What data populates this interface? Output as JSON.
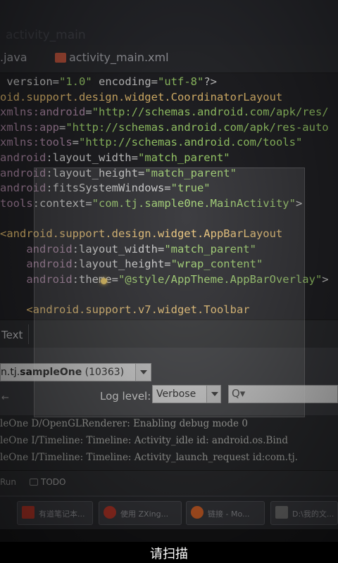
{
  "camera_view": {
    "title_ghost": "activity_main",
    "tabs": {
      "java": ".java",
      "xml": "activity_main.xml"
    },
    "code_lines": [
      [
        {
          "t": " version=",
          "c": "plain"
        },
        {
          "t": "\"1.0\"",
          "c": "str"
        },
        {
          "t": " encoding=",
          "c": "plain"
        },
        {
          "t": "\"utf-8\"",
          "c": "str"
        },
        {
          "t": "?>",
          "c": "plain"
        }
      ],
      [
        {
          "t": "oid.support.design.widget.CoordinatorLayout",
          "c": "tag"
        }
      ],
      [
        {
          "t": "xmlns:",
          "c": "ns"
        },
        {
          "t": "android",
          "c": "ns"
        },
        {
          "t": "=",
          "c": "plain"
        },
        {
          "t": "\"http://schemas.android.com/apk/res/",
          "c": "str"
        }
      ],
      [
        {
          "t": "xmlns:",
          "c": "ns"
        },
        {
          "t": "app",
          "c": "ns"
        },
        {
          "t": "=",
          "c": "plain"
        },
        {
          "t": "\"http://schemas.android.com/apk/res-auto",
          "c": "str"
        }
      ],
      [
        {
          "t": "xmlns:",
          "c": "ns"
        },
        {
          "t": "tools",
          "c": "ns"
        },
        {
          "t": "=",
          "c": "plain"
        },
        {
          "t": "\"http://schemas.android.com/tools\"",
          "c": "str"
        }
      ],
      [
        {
          "t": "android",
          "c": "ns"
        },
        {
          "t": ":layout_width=",
          "c": "plain"
        },
        {
          "t": "\"match_parent\"",
          "c": "str"
        }
      ],
      [
        {
          "t": "android",
          "c": "ns"
        },
        {
          "t": ":layout_height=",
          "c": "plain"
        },
        {
          "t": "\"match_parent\"",
          "c": "str"
        }
      ],
      [
        {
          "t": "android",
          "c": "ns"
        },
        {
          "t": ":fitsSystemWindows=",
          "c": "plain"
        },
        {
          "t": "\"true\"",
          "c": "str"
        }
      ],
      [
        {
          "t": "tools",
          "c": "ns"
        },
        {
          "t": ":context=",
          "c": "plain"
        },
        {
          "t": "\"com.tj.sample0ne.MainActivity\"",
          "c": "str"
        },
        {
          "t": ">",
          "c": "plain"
        }
      ],
      [],
      [
        {
          "t": "<android.support.design.widget.AppBarLayout",
          "c": "tag"
        }
      ],
      [
        {
          "t": "    android",
          "c": "ns"
        },
        {
          "t": ":layout_width=",
          "c": "plain"
        },
        {
          "t": "\"match_parent\"",
          "c": "str"
        }
      ],
      [
        {
          "t": "    android",
          "c": "ns"
        },
        {
          "t": ":layout_height=",
          "c": "plain"
        },
        {
          "t": "\"wrap_content\"",
          "c": "str"
        }
      ],
      [
        {
          "t": "    android",
          "c": "ns"
        },
        {
          "t": ":theme=",
          "c": "plain"
        },
        {
          "t": "\"@style/AppTheme.AppBarOverlay\"",
          "c": "str"
        },
        {
          "t": ">",
          "c": "plain"
        }
      ],
      [],
      [
        {
          "t": "    <android.support.v7.widget.Toolbar",
          "c": "tag"
        }
      ]
    ],
    "panel_tab": "Text",
    "process": {
      "name_prefix": "n.tj.",
      "name_bold": "sampleOne",
      "pid": " (10363)"
    },
    "side_arrow": "←",
    "log_level_label": "Log level:",
    "log_level_value": "Verbose",
    "search_glyph": "Q▾",
    "log_lines": [
      "leOne D/OpenGLRenderer: Enabling debug mode 0",
      "leOne I/Timeline: Timeline: Activity_idle id: android.os.Bind",
      "leOne I/Timeline: Timeline: Activity_launch_request id:com.tj."
    ],
    "bottom_tools": {
      "run": "Run",
      "todo": "TODO"
    },
    "taskbar_items": [
      {
        "label": "有道笔记本...",
        "color": "#c0392b"
      },
      {
        "label": "使用 ZXing...",
        "color": "#c0392b"
      },
      {
        "label": "链接 - Mo...",
        "color": "#e66b2c"
      },
      {
        "label": "D:\\我的文...",
        "color": "#777777"
      }
    ]
  },
  "hint": "请扫描"
}
